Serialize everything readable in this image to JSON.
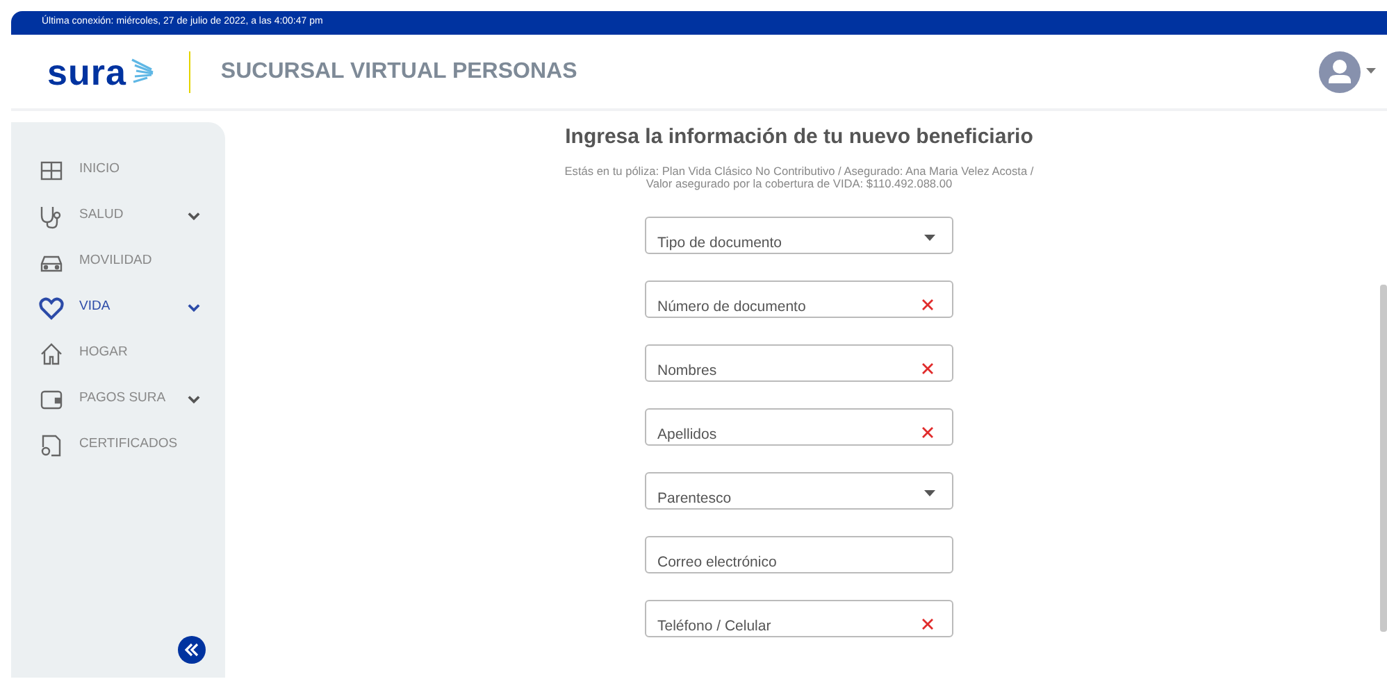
{
  "top_bar": {
    "last_login": "Última conexión: miércoles, 27 de julio de 2022, a las 4:00:47 pm"
  },
  "header": {
    "logo": "sura",
    "title": "SUCURSAL VIRTUAL PERSONAS"
  },
  "sidebar": {
    "items": [
      {
        "label": "INICIO",
        "expandable": false,
        "selected": false
      },
      {
        "label": "SALUD",
        "expandable": true,
        "selected": false
      },
      {
        "label": "MOVILIDAD",
        "expandable": false,
        "selected": false
      },
      {
        "label": "VIDA",
        "expandable": true,
        "selected": true
      },
      {
        "label": "HOGAR",
        "expandable": false,
        "selected": false
      },
      {
        "label": "PAGOS SURA",
        "expandable": true,
        "selected": false
      },
      {
        "label": "CERTIFICADOS",
        "expandable": false,
        "selected": false
      }
    ]
  },
  "form": {
    "title": "Ingresa la información de tu nuevo beneficiario",
    "subtitle_lines": [
      "Estás en tu póliza: Plan Vida Clásico No Contributivo / Asegurado: Ana Maria Velez Acosta /",
      "Valor asegurado por la cobertura de VIDA: $110.492.088.00"
    ],
    "fields": [
      {
        "kind": "select",
        "placeholder": "Tipo de documento",
        "invalid": false
      },
      {
        "kind": "text",
        "placeholder": "Número de documento",
        "invalid": true
      },
      {
        "kind": "text",
        "placeholder": "Nombres",
        "invalid": true
      },
      {
        "kind": "text",
        "placeholder": "Apellidos",
        "invalid": true
      },
      {
        "kind": "select",
        "placeholder": "Parentesco",
        "invalid": false
      },
      {
        "kind": "text",
        "placeholder": "Correo electrónico",
        "invalid": false
      },
      {
        "kind": "text",
        "placeholder": "Teléfono / Celular",
        "invalid": true
      }
    ]
  }
}
